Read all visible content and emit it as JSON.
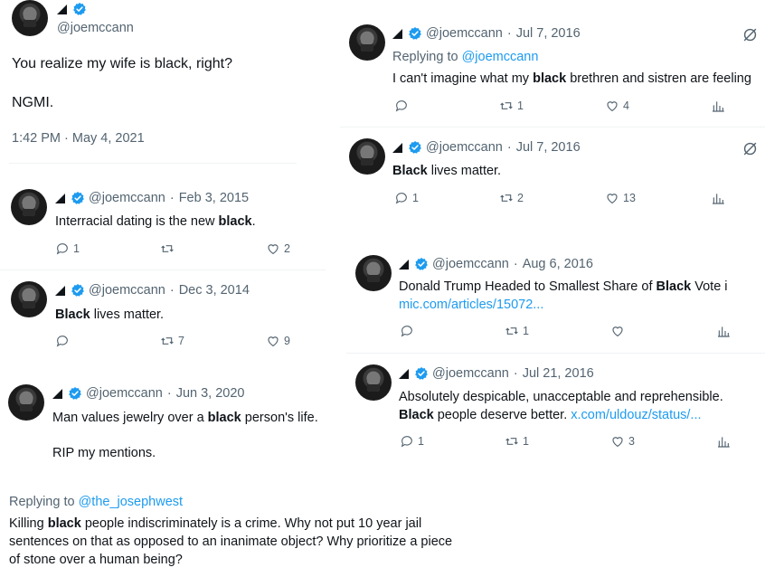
{
  "main": {
    "handle": "@joemccann",
    "body_line1": "You realize my wife is black, right?",
    "body_line2": "NGMI.",
    "timestamp": "1:42 PM · May 4, 2021"
  },
  "replies_left": [
    {
      "handle": "@joemccann",
      "date": "Feb 3, 2015",
      "t1": "Interracial dating is the new ",
      "b1": "black",
      "t2": ".",
      "replies": "1",
      "retweets": "",
      "likes": "2"
    },
    {
      "handle": "@joemccann",
      "date": "Dec 3, 2014",
      "b1": "Black",
      "t2": " lives matter.",
      "replies": "",
      "retweets": "7",
      "likes": "9"
    },
    {
      "handle": "@joemccann",
      "date": "Jun 3, 2020",
      "t1": "Man values jewelry over a ",
      "b1": "black",
      "t2": " person's life.",
      "line2": "RIP my mentions."
    }
  ],
  "bottom": {
    "replying_label": "Replying to ",
    "replying_handle": "@the_josephwest",
    "l1a": "Killing ",
    "l1b": "black",
    "l1c": " people indiscriminately is a crime.  Why not put 10 year jail",
    "l2": "sentences on that as opposed to an inanimate object?  Why prioritize a piece",
    "l3": "of stone over a human being?"
  },
  "right": [
    {
      "handle": "@joemccann",
      "date": "Jul 7, 2016",
      "replying_label": "Replying to ",
      "replying_handle": "@joemccann",
      "t1": "I can't imagine what my ",
      "b1": "black",
      "t2": " brethren and sistren are feeling",
      "replies": "",
      "retweets": "1",
      "likes": "4"
    },
    {
      "handle": "@joemccann",
      "date": "Jul 7, 2016",
      "b1": "Black",
      "t2": " lives matter.",
      "replies": "1",
      "retweets": "2",
      "likes": "13"
    },
    {
      "handle": "@joemccann",
      "date": "Aug 6, 2016",
      "t1": "Donald Trump Headed to Smallest Share of ",
      "b1": "Black",
      "t2": " Vote i",
      "link": "mic.com/articles/15072...",
      "replies": "",
      "retweets": "1",
      "likes": ""
    },
    {
      "handle": "@joemccann",
      "date": "Jul 21, 2016",
      "l1": "Absolutely despicable, unacceptable and reprehensible.",
      "b1": "Black",
      "t2": " people deserve better. ",
      "link": "x.com/uldouz/status/...",
      "replies": "1",
      "retweets": "1",
      "likes": "3"
    }
  ],
  "dot": "·"
}
